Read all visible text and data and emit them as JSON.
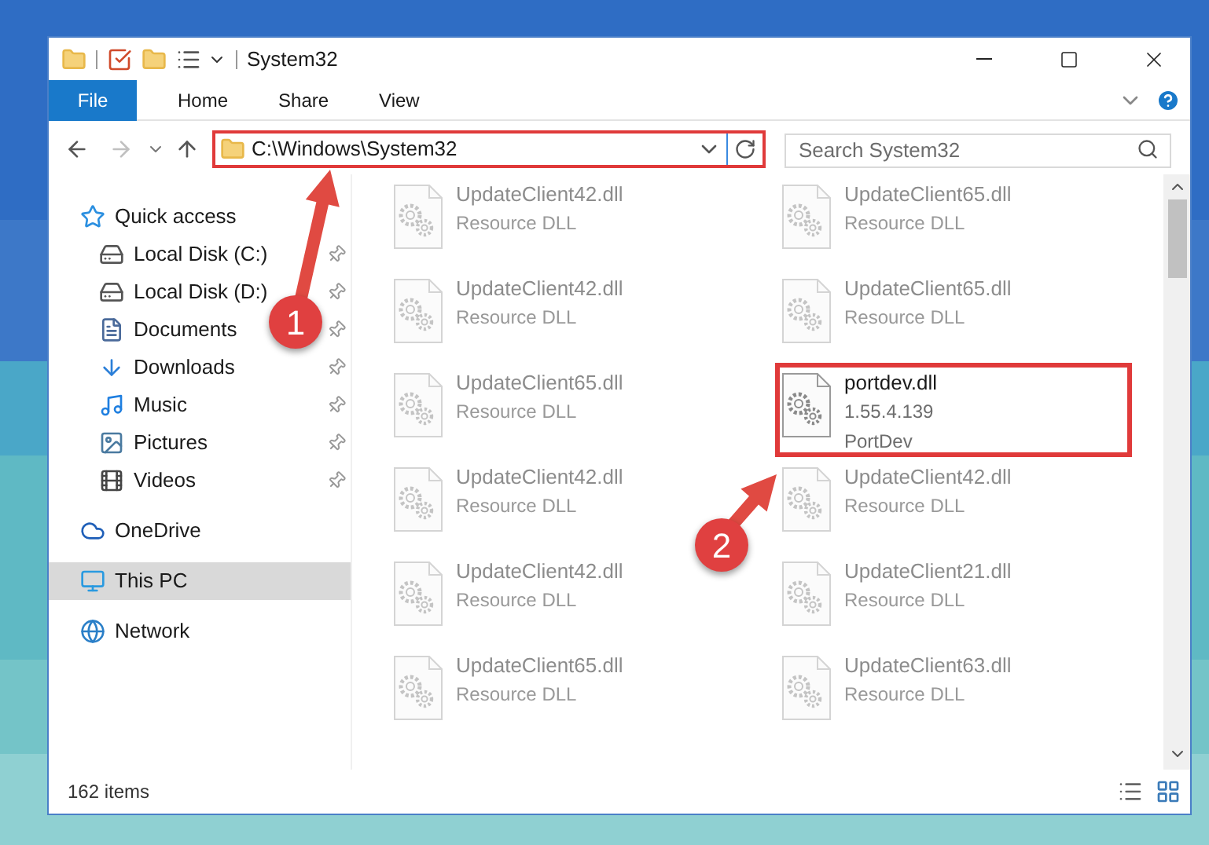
{
  "window": {
    "title": "System32"
  },
  "ribbon_tabs": [
    {
      "label": "File",
      "kind": "file",
      "selected": false
    },
    {
      "label": "Home",
      "kind": "tab",
      "selected": false
    },
    {
      "label": "Share",
      "kind": "tab",
      "selected": false
    },
    {
      "label": "View",
      "kind": "tab",
      "selected": false
    }
  ],
  "address": {
    "path": "C:\\Windows\\System32"
  },
  "search": {
    "placeholder": "Search System32"
  },
  "sidebar": {
    "items": [
      {
        "label": "Quick access",
        "kind": "star",
        "selected": false,
        "children": [
          {
            "label": "Local Disk (C:)",
            "kind": "system_drive",
            "pinned": true,
            "selected": false
          },
          {
            "label": "Local Disk (D:)",
            "kind": "drive",
            "pinned": true,
            "selected": false
          },
          {
            "label": "Documents",
            "kind": "documents",
            "pinned": true,
            "selected": false
          },
          {
            "label": "Downloads",
            "kind": "downloads",
            "pinned": true,
            "selected": false
          },
          {
            "label": "Music",
            "kind": "music",
            "pinned": true,
            "selected": false
          },
          {
            "label": "Pictures",
            "kind": "pictures",
            "pinned": true,
            "selected": false
          },
          {
            "label": "Videos",
            "kind": "videos",
            "pinned": true,
            "selected": false
          }
        ]
      },
      {
        "label": "OneDrive",
        "kind": "cloud",
        "selected": false
      },
      {
        "label": "This PC",
        "kind": "pc",
        "selected": true
      },
      {
        "label": "Network",
        "kind": "network",
        "selected": false
      }
    ]
  },
  "files": [
    {
      "name": "UpdateClient42.dll",
      "details": [
        "Resource DLL"
      ],
      "blurred": true,
      "highlighted": false
    },
    {
      "name": "UpdateClient65.dll",
      "details": [
        "Resource DLL"
      ],
      "blurred": true,
      "highlighted": false
    },
    {
      "name": "UpdateClient42.dll",
      "details": [
        "Resource DLL"
      ],
      "blurred": true,
      "highlighted": false
    },
    {
      "name": "UpdateClient65.dll",
      "details": [
        "Resource DLL"
      ],
      "blurred": true,
      "highlighted": false
    },
    {
      "name": "UpdateClient65.dll",
      "details": [
        "Resource DLL"
      ],
      "blurred": true,
      "highlighted": false
    },
    {
      "name": "portdev.dll",
      "details": [
        "1.55.4.139",
        "PortDev"
      ],
      "blurred": false,
      "highlighted": true
    },
    {
      "name": "UpdateClient42.dll",
      "details": [
        "Resource DLL"
      ],
      "blurred": true,
      "highlighted": false
    },
    {
      "name": "UpdateClient42.dll",
      "details": [
        "Resource DLL"
      ],
      "blurred": true,
      "highlighted": false
    },
    {
      "name": "UpdateClient42.dll",
      "details": [
        "Resource DLL"
      ],
      "blurred": true,
      "highlighted": false
    },
    {
      "name": "UpdateClient21.dll",
      "details": [
        "Resource DLL"
      ],
      "blurred": true,
      "highlighted": false
    },
    {
      "name": "UpdateClient65.dll",
      "details": [
        "Resource DLL"
      ],
      "blurred": true,
      "highlighted": false
    },
    {
      "name": "UpdateClient63.dll",
      "details": [
        "Resource DLL"
      ],
      "blurred": true,
      "highlighted": false
    }
  ],
  "status_bar": {
    "item_count": "162 items"
  },
  "annotations": [
    {
      "label": "1"
    },
    {
      "label": "2"
    }
  ]
}
